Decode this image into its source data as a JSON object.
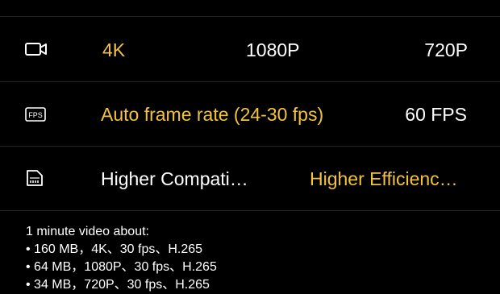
{
  "colors": {
    "selected": "#f3c33c",
    "text": "#ffffff",
    "background": "#000000",
    "divider": "#222222"
  },
  "rows": [
    {
      "icon": "video-camera-icon",
      "options": [
        {
          "label": "4K",
          "selected": true
        },
        {
          "label": "1080P",
          "selected": false
        },
        {
          "label": "720P",
          "selected": false
        }
      ]
    },
    {
      "icon": "fps-icon",
      "icon_text": "FPS",
      "options": [
        {
          "label": "Auto frame rate (24-30 fps)",
          "selected": true
        },
        {
          "label": "60 FPS",
          "selected": false
        }
      ]
    },
    {
      "icon": "codec-icon",
      "options": [
        {
          "label": "Higher Compati…",
          "selected": false
        },
        {
          "label": "Higher Efficienc…",
          "selected": true
        }
      ]
    }
  ],
  "info": {
    "heading": "1 minute video about:",
    "lines": [
      "• 160 MB，4K、30 fps、H.265",
      "• 64 MB，1080P、30 fps、H.265",
      "• 34 MB，720P、30 fps、H.265"
    ]
  }
}
